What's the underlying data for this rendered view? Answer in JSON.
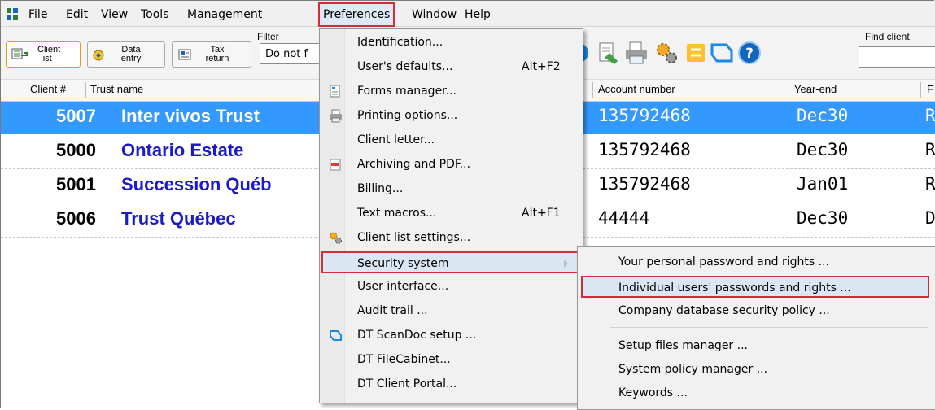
{
  "menubar": {
    "items": [
      "File",
      "Edit",
      "View",
      "Tools",
      "Management",
      "Preferences",
      "Window",
      "Help"
    ],
    "active": "Preferences"
  },
  "toolbar": {
    "tabs": [
      {
        "label": "Client\nlist",
        "selected": true
      },
      {
        "label": "Data\nentry",
        "selected": false
      },
      {
        "label": "Tax\nreturn",
        "selected": false
      }
    ],
    "filter_label": "Filter",
    "filter_value": "Do not f",
    "find_label": "Find client",
    "find_value": "",
    "icons": [
      "globe-icon",
      "edit-document-icon",
      "printer-icon",
      "settings-gears-icon",
      "note-icon",
      "scandoc-icon",
      "help-icon"
    ]
  },
  "columns": {
    "client_num": "Client #",
    "trust_name": "Trust name",
    "account": "Account number",
    "year_end": "Year-end",
    "last": "F"
  },
  "rows": [
    {
      "num": "5007",
      "name": "Inter vivos Trust",
      "account": "135792468",
      "year_end": "Dec30",
      "last": "R",
      "selected": true
    },
    {
      "num": "5000",
      "name": "Ontario Estate",
      "account": "135792468",
      "year_end": "Dec30",
      "last": "R",
      "selected": false
    },
    {
      "num": "5001",
      "name": "Succession Québ",
      "account": "135792468",
      "year_end": "Jan01",
      "last": "R",
      "selected": false
    },
    {
      "num": "5006",
      "name": "Trust Québec",
      "account": "44444",
      "year_end": "Dec30",
      "last": "D",
      "selected": false
    }
  ],
  "pref_menu": {
    "items": [
      {
        "label": "Identification...",
        "shortcut": "",
        "icon": ""
      },
      {
        "label": "User's defaults...",
        "shortcut": "Alt+F2",
        "icon": ""
      },
      {
        "label": "Forms manager...",
        "shortcut": "",
        "icon": "forms-icon"
      },
      {
        "label": "Printing options...",
        "shortcut": "",
        "icon": "printer-icon"
      },
      {
        "label": "Client letter...",
        "shortcut": "",
        "icon": ""
      },
      {
        "label": "Archiving and PDF...",
        "shortcut": "",
        "icon": "pdf-icon"
      },
      {
        "label": "Billing...",
        "shortcut": "",
        "icon": ""
      },
      {
        "label": "Text macros...",
        "shortcut": "Alt+F1",
        "icon": ""
      },
      {
        "label": "Client list settings...",
        "shortcut": "",
        "icon": "gears-icon"
      },
      {
        "label": "Security system",
        "shortcut": "",
        "icon": "",
        "submenu": true,
        "highlighted": true
      },
      {
        "label": "User interface...",
        "shortcut": "",
        "icon": ""
      },
      {
        "label": "Audit trail ...",
        "shortcut": "",
        "icon": ""
      },
      {
        "label": "DT ScanDoc setup ...",
        "shortcut": "",
        "icon": "scandoc-icon"
      },
      {
        "label": "DT FileCabinet...",
        "shortcut": "",
        "icon": ""
      },
      {
        "label": "DT Client Portal...",
        "shortcut": "",
        "icon": ""
      }
    ]
  },
  "security_submenu": {
    "items": [
      {
        "label": "Your personal password and rights ...",
        "highlighted": false
      },
      {
        "label": "Individual users' passwords and rights ...",
        "highlighted": true
      },
      {
        "label": "Company database security policy ...",
        "highlighted": false
      },
      {
        "label": "Setup files manager ...",
        "highlighted": false
      },
      {
        "label": "System policy manager ...",
        "highlighted": false
      },
      {
        "label": "Keywords ...",
        "highlighted": false
      }
    ]
  },
  "colors": {
    "selection": "#3399ff",
    "client_name": "#1a1acb",
    "highlight_box": "#d42c38",
    "menu_bg": "#f1f1f1"
  }
}
